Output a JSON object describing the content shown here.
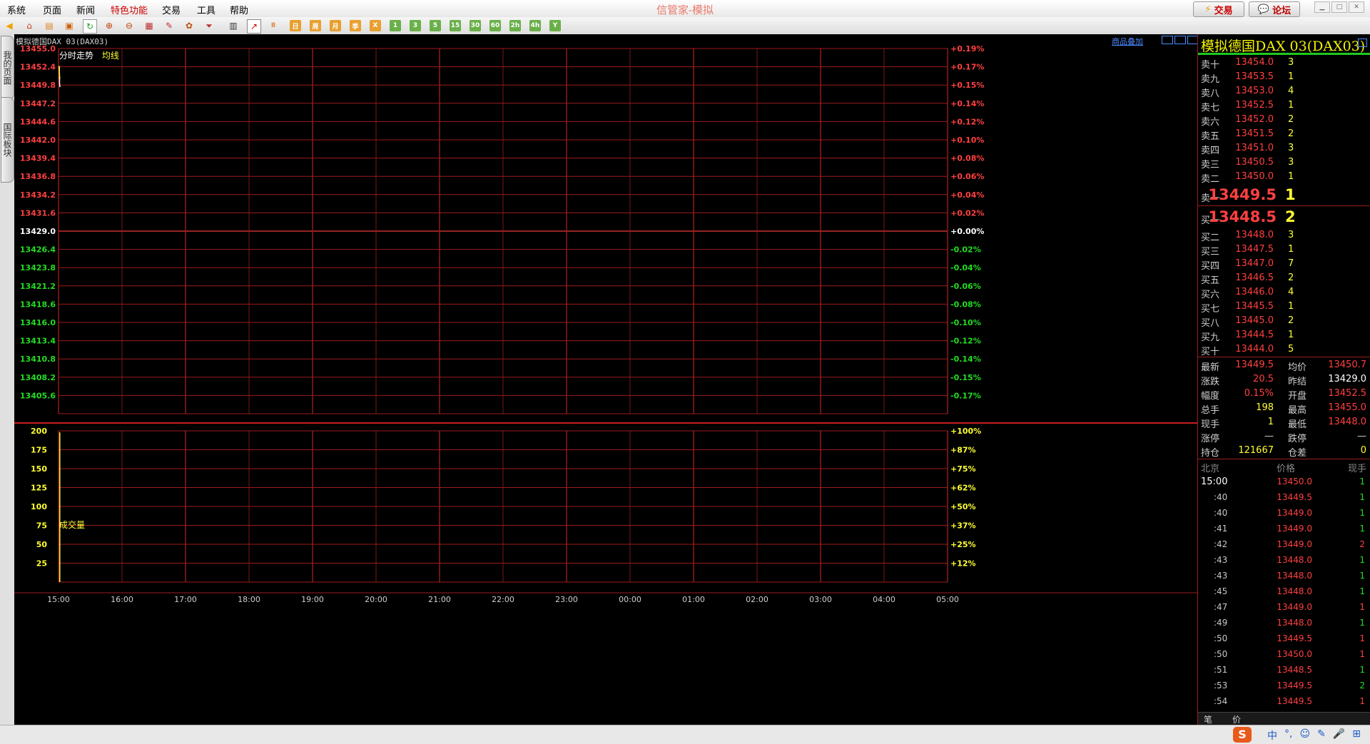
{
  "app_title": "信管家-模拟",
  "menu": [
    "系统",
    "页面",
    "新闻",
    "特色功能",
    "交易",
    "工具",
    "帮助"
  ],
  "menu_highlight": "特色功能",
  "top_buttons": {
    "trade": "交易",
    "forum": "论坛"
  },
  "toolbar_periods": [
    "日",
    "周",
    "月",
    "季",
    "X",
    "1",
    "3",
    "5",
    "15",
    "30",
    "60",
    "2h",
    "4h",
    "Y"
  ],
  "left_tabs": [
    "我的页面",
    "国际板块"
  ],
  "chart": {
    "symbol_label": "模拟德国DAX 03(DAX03)",
    "top_right_link": "商品叠加",
    "price_legend": [
      "分时走势",
      "均线"
    ],
    "volume_label": "成交量"
  },
  "chart_data": [
    {
      "type": "line",
      "title": "分时走势",
      "y_tick_labels": [
        "13455.0",
        "13452.4",
        "13449.8",
        "13447.2",
        "13444.6",
        "13442.0",
        "13439.4",
        "13436.8",
        "13434.2",
        "13431.6",
        "13429.0",
        "13426.4",
        "13423.8",
        "13421.2",
        "13418.6",
        "13416.0",
        "13413.4",
        "13410.8",
        "13408.2",
        "13405.6"
      ],
      "y_ticks": [
        13455.0,
        13452.4,
        13449.8,
        13447.2,
        13444.6,
        13442.0,
        13439.4,
        13436.8,
        13434.2,
        13431.6,
        13429.0,
        13426.4,
        13423.8,
        13421.2,
        13418.6,
        13416.0,
        13413.4,
        13410.8,
        13408.2,
        13405.6
      ],
      "pct_tick_labels": [
        "+0.19%",
        "+0.17%",
        "+0.15%",
        "+0.14%",
        "+0.12%",
        "+0.10%",
        "+0.08%",
        "+0.06%",
        "+0.04%",
        "+0.02%",
        "+0.00%",
        "-0.02%",
        "-0.04%",
        "-0.06%",
        "-0.08%",
        "-0.10%",
        "-0.12%",
        "-0.14%",
        "-0.15%",
        "-0.17%"
      ],
      "ylim": [
        13403.0,
        13455.0
      ],
      "baseline": 13429.0,
      "x_tick_labels": [
        "15:00",
        "16:00",
        "17:00",
        "18:00",
        "19:00",
        "20:00",
        "21:00",
        "22:00",
        "23:00",
        "00:00",
        "01:00",
        "02:00",
        "03:00",
        "04:00",
        "05:00"
      ],
      "series": [
        {
          "name": "分时走势",
          "values": [
            13452.5,
            13450.0,
            13449.5
          ]
        },
        {
          "name": "均线",
          "values": [
            13452.5,
            13451.0,
            13450.7
          ]
        }
      ]
    },
    {
      "type": "bar",
      "title": "成交量",
      "y_tick_labels": [
        "200",
        "175",
        "150",
        "125",
        "100",
        "75",
        "50",
        "25"
      ],
      "y_ticks": [
        200,
        175,
        150,
        125,
        100,
        75,
        50,
        25
      ],
      "pct_tick_labels": [
        "+100%",
        "+87%",
        "+75%",
        "+62%",
        "+50%",
        "+37%",
        "+25%",
        "+12%"
      ],
      "ylim": [
        0,
        200
      ],
      "values": [
        198
      ]
    }
  ],
  "quote": {
    "title": "模拟德国DAX 03(DAX03)",
    "asks": [
      {
        "label": "卖十",
        "price": "13454.0",
        "vol": "3"
      },
      {
        "label": "卖九",
        "price": "13453.5",
        "vol": "1"
      },
      {
        "label": "卖八",
        "price": "13453.0",
        "vol": "4"
      },
      {
        "label": "卖七",
        "price": "13452.5",
        "vol": "1"
      },
      {
        "label": "卖六",
        "price": "13452.0",
        "vol": "2"
      },
      {
        "label": "卖五",
        "price": "13451.5",
        "vol": "2"
      },
      {
        "label": "卖四",
        "price": "13451.0",
        "vol": "3"
      },
      {
        "label": "卖三",
        "price": "13450.5",
        "vol": "3"
      },
      {
        "label": "卖二",
        "price": "13450.0",
        "vol": "1"
      }
    ],
    "ask1": {
      "label": "卖一",
      "price": "13449.5",
      "vol": "1"
    },
    "bid1": {
      "label": "买一",
      "price": "13448.5",
      "vol": "2"
    },
    "bids": [
      {
        "label": "买二",
        "price": "13448.0",
        "vol": "3"
      },
      {
        "label": "买三",
        "price": "13447.5",
        "vol": "1"
      },
      {
        "label": "买四",
        "price": "13447.0",
        "vol": "7"
      },
      {
        "label": "买五",
        "price": "13446.5",
        "vol": "2"
      },
      {
        "label": "买六",
        "price": "13446.0",
        "vol": "4"
      },
      {
        "label": "买七",
        "price": "13445.5",
        "vol": "1"
      },
      {
        "label": "买八",
        "price": "13445.0",
        "vol": "2"
      },
      {
        "label": "买九",
        "price": "13444.5",
        "vol": "1"
      },
      {
        "label": "买十",
        "price": "13444.0",
        "vol": "5"
      }
    ],
    "stats": [
      {
        "l1": "最新",
        "v1": "13449.5",
        "c1": "#ff4040",
        "l2": "均价",
        "v2": "13450.7",
        "c2": "#ff4040"
      },
      {
        "l1": "涨跌",
        "v1": "20.5",
        "c1": "#ff4040",
        "l2": "昨结",
        "v2": "13429.0",
        "c2": "#ffffff"
      },
      {
        "l1": "幅度",
        "v1": "0.15%",
        "c1": "#ff4040",
        "l2": "开盘",
        "v2": "13452.5",
        "c2": "#ff4040"
      },
      {
        "l1": "总手",
        "v1": "198",
        "c1": "#ffff33",
        "l2": "最高",
        "v2": "13455.0",
        "c2": "#ff4040"
      },
      {
        "l1": "现手",
        "v1": "1",
        "c1": "#ffff33",
        "l2": "最低",
        "v2": "13448.0",
        "c2": "#ff4040"
      },
      {
        "l1": "涨停",
        "v1": "—",
        "c1": "#d0d0d0",
        "l2": "跌停",
        "v2": "—",
        "c2": "#d0d0d0"
      },
      {
        "l1": "持仓",
        "v1": "121667",
        "c1": "#ffff33",
        "l2": "仓差",
        "v2": "0",
        "c2": "#ffff33"
      }
    ],
    "ticks_header": {
      "time": "北京",
      "price": "价格",
      "vol": "现手"
    },
    "ticks": [
      {
        "time": "15:00",
        "price": "13450.0",
        "vol": "1",
        "vc": "#22dd22"
      },
      {
        "time": ":40",
        "price": "13449.5",
        "vol": "1",
        "vc": "#22dd22"
      },
      {
        "time": ":40",
        "price": "13449.0",
        "vol": "1",
        "vc": "#22dd22"
      },
      {
        "time": ":41",
        "price": "13449.0",
        "vol": "1",
        "vc": "#22dd22"
      },
      {
        "time": ":42",
        "price": "13449.0",
        "vol": "2",
        "vc": "#ff4040"
      },
      {
        "time": ":43",
        "price": "13448.0",
        "vol": "1",
        "vc": "#22dd22"
      },
      {
        "time": ":43",
        "price": "13448.0",
        "vol": "1",
        "vc": "#22dd22"
      },
      {
        "time": ":45",
        "price": "13448.0",
        "vol": "1",
        "vc": "#22dd22"
      },
      {
        "time": ":47",
        "price": "13449.0",
        "vol": "1",
        "vc": "#ff4040"
      },
      {
        "time": ":49",
        "price": "13448.0",
        "vol": "1",
        "vc": "#22dd22"
      },
      {
        "time": ":50",
        "price": "13449.5",
        "vol": "1",
        "vc": "#ff4040"
      },
      {
        "time": ":50",
        "price": "13450.0",
        "vol": "1",
        "vc": "#ff4040"
      },
      {
        "time": ":51",
        "price": "13448.5",
        "vol": "1",
        "vc": "#22dd22"
      },
      {
        "time": ":53",
        "price": "13449.5",
        "vol": "2",
        "vc": "#22dd22"
      },
      {
        "time": ":54",
        "price": "13449.5",
        "vol": "1",
        "vc": "#ff4040"
      }
    ],
    "bottom_tabs": [
      "笔",
      "价"
    ]
  },
  "colors": {
    "bg": "#000000",
    "grid": "#9b1c1c",
    "up": "#ff4040",
    "down": "#22dd22",
    "yellow": "#ffff33",
    "white": "#ffffff"
  },
  "tray": [
    "中",
    "°,",
    "☺",
    "✎",
    "🎤",
    "⊞"
  ]
}
